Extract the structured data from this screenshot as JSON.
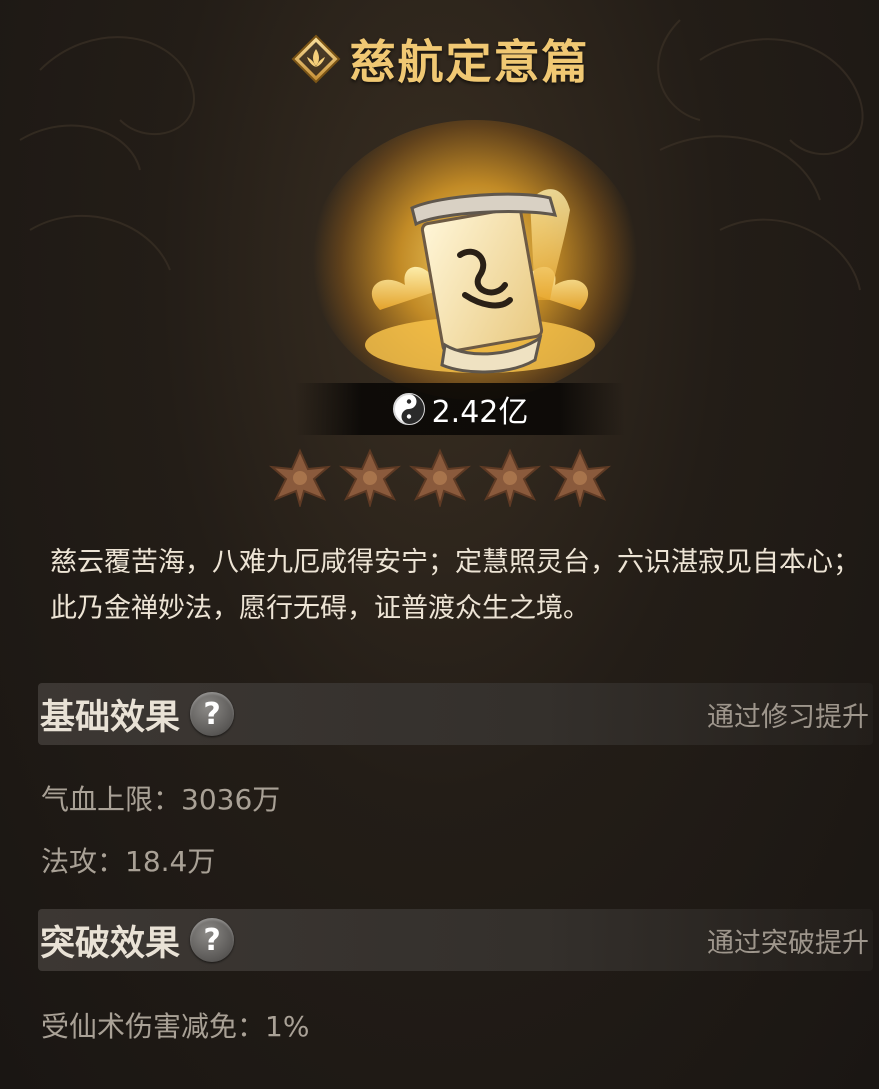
{
  "header": {
    "title": "慈航定意篇",
    "emblem_icon": "lotus-emblem-icon"
  },
  "item": {
    "icon": "golden-scroll-icon",
    "price_icon": "yin-yang-coin-icon",
    "price": "2.42亿",
    "star_count": 5,
    "star_icon": "flower-star-icon"
  },
  "description": "慈云覆苦海，八难九厄咸得安宁；定慧照灵台，六识湛寂见自本心；此乃金禅妙法，愿行无碍，证普渡众生之境。",
  "basic_effects": {
    "title": "基础效果",
    "help_label": "?",
    "hint": "通过修习提升",
    "stats": [
      "气血上限：3036万",
      "法攻：18.4万"
    ]
  },
  "breakthrough_effects": {
    "title": "突破效果",
    "help_label": "?",
    "hint": "通过突破提升",
    "stats": [
      "受仙术伤害减免：1%"
    ]
  },
  "colors": {
    "title_gold": "#f0c873",
    "background": "#231d17",
    "star_bronze": "#8a5a3c"
  }
}
